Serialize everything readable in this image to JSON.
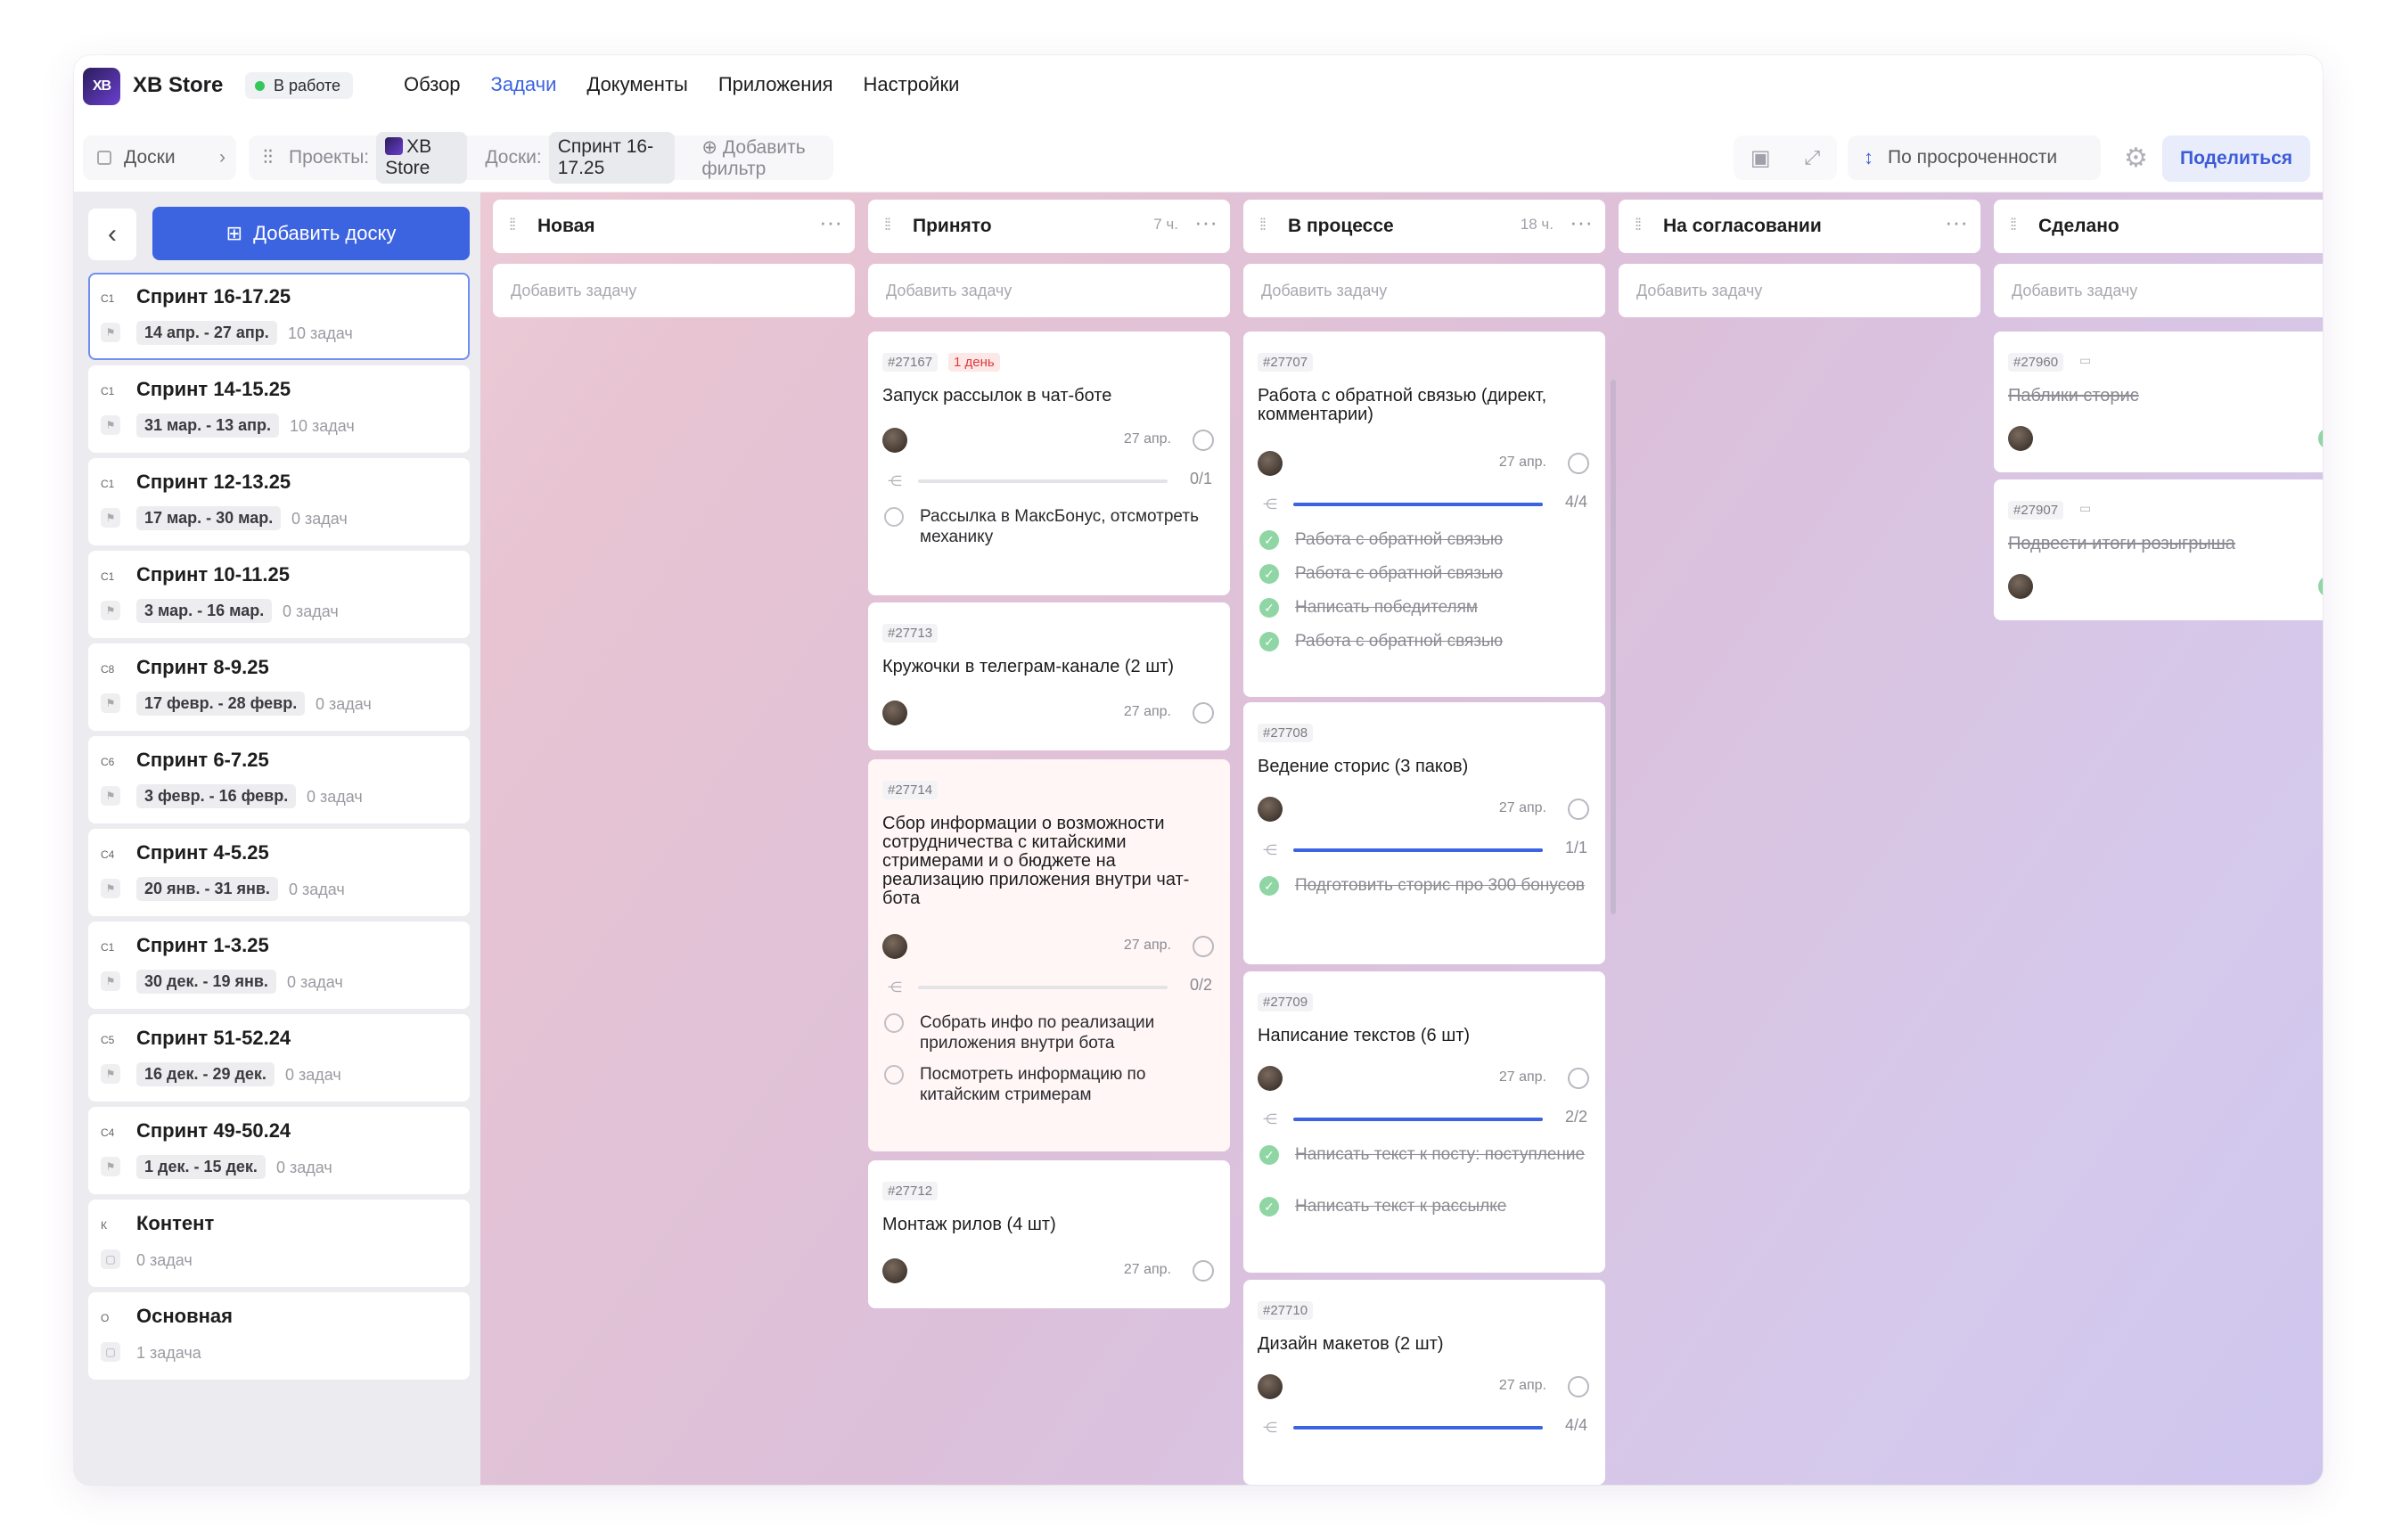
{
  "app": {
    "name": "XB Store",
    "logo_text": "XB",
    "status": "В работе"
  },
  "nav": [
    "Обзор",
    "Задачи",
    "Документы",
    "Приложения",
    "Настройки"
  ],
  "filters": {
    "boards_label": "Доски",
    "projects_label": "Проекты:",
    "project_value": "XB Store",
    "boards_filter_label": "Доски:",
    "boards_filter_value": "Спринт 16-17.25",
    "add_filter": "Добавить фильтр",
    "sort": "По просроченности",
    "share": "Поделиться"
  },
  "sidebar": {
    "add_board": "Добавить доску",
    "boards": [
      {
        "code": "С1",
        "name": "Спринт 16-17.25",
        "dates": "14 апр. - 27 апр.",
        "count": "10 задач"
      },
      {
        "code": "С1",
        "name": "Спринт 14-15.25",
        "dates": "31 мар. - 13 апр.",
        "count": "10 задач"
      },
      {
        "code": "С1",
        "name": "Спринт 12-13.25",
        "dates": "17 мар. - 30 мар.",
        "count": "0 задач"
      },
      {
        "code": "С1",
        "name": "Спринт 10-11.25",
        "dates": "3 мар. - 16 мар.",
        "count": "0 задач"
      },
      {
        "code": "С8",
        "name": "Спринт 8-9.25",
        "dates": "17 февр. - 28 февр.",
        "count": "0 задач"
      },
      {
        "code": "С6",
        "name": "Спринт 6-7.25",
        "dates": "3 февр. - 16 февр.",
        "count": "0 задач"
      },
      {
        "code": "С4",
        "name": "Спринт 4-5.25",
        "dates": "20 янв. - 31 янв.",
        "count": "0 задач"
      },
      {
        "code": "С1",
        "name": "Спринт 1-3.25",
        "dates": "30 дек. - 19 янв.",
        "count": "0 задач"
      },
      {
        "code": "С5",
        "name": "Спринт 51-52.24",
        "dates": "16 дек. - 29 дек.",
        "count": "0 задач"
      },
      {
        "code": "С4",
        "name": "Спринт 49-50.24",
        "dates": "1 дек. - 15 дек.",
        "count": "0 задач"
      },
      {
        "code": "К",
        "name": "Контент",
        "dates": "",
        "count": "0 задач"
      },
      {
        "code": "О",
        "name": "Основная",
        "dates": "",
        "count": "1 задача"
      }
    ]
  },
  "columns": [
    {
      "title": "Новая",
      "hours": ""
    },
    {
      "title": "Принято",
      "hours": "7 ч."
    },
    {
      "title": "В процессе",
      "hours": "18 ч."
    },
    {
      "title": "На согласовании",
      "hours": ""
    },
    {
      "title": "Сделано",
      "hours": ""
    }
  ],
  "add_task": "Добавить задачу",
  "cards": {
    "accepted": [
      {
        "id": "#27167",
        "badge": "1 день",
        "title": "Запуск рассылок в чат-боте",
        "date": "27 апр.",
        "progress": "0/1",
        "progress_frac": 0,
        "checklist": [
          {
            "text": "Рассылка в МаксБонус, отсмотреть механику",
            "done": false
          }
        ]
      },
      {
        "id": "#27713",
        "title": "Кружочки в телеграм-канале (2 шт)",
        "date": "27 апр."
      },
      {
        "id": "#27714",
        "title": "Сбор информации о возможности сотрудничества с китайскими стримерами и о бюджете на реализацию приложения внутри чат-бота",
        "date": "27 апр.",
        "progress": "0/2",
        "progress_frac": 0,
        "checklist": [
          {
            "text": "Собрать инфо по реализации приложения внутри бота",
            "done": false
          },
          {
            "text": "Посмотреть информацию по китайским стримерам",
            "done": false
          }
        ]
      },
      {
        "id": "#27712",
        "title": "Монтаж рилов (4 шт)",
        "date": "27 апр."
      }
    ],
    "in_progress": [
      {
        "id": "#27707",
        "title": "Работа с обратной связью (директ, комментарии)",
        "date": "27 апр.",
        "progress": "4/4",
        "progress_frac": 1,
        "checklist": [
          {
            "text": "Работа с обратной связью",
            "done": true
          },
          {
            "text": "Работа с обратной связью",
            "done": true
          },
          {
            "text": "Написать победителям",
            "done": true
          },
          {
            "text": "Работа с обратной связью",
            "done": true
          }
        ]
      },
      {
        "id": "#27708",
        "title": "Ведение сторис (3 паков)",
        "date": "27 апр.",
        "progress": "1/1",
        "progress_frac": 1,
        "checklist": [
          {
            "text": "Подготовить сторис про 300 бонусов",
            "done": true
          }
        ]
      },
      {
        "id": "#27709",
        "title": "Написание текстов (6 шт)",
        "date": "27 апр.",
        "progress": "2/2",
        "progress_frac": 1,
        "checklist": [
          {
            "text": "Написать текст к посту: поступление",
            "done": true
          },
          {
            "text": "Написать текст к рассылке",
            "done": true
          }
        ]
      },
      {
        "id": "#27710",
        "title": "Дизайн макетов (2 шт)",
        "date": "27 апр.",
        "progress": "4/4",
        "progress_frac": 1
      }
    ],
    "done": [
      {
        "id": "#27960",
        "title": "Паблики сторис"
      },
      {
        "id": "#27907",
        "title": "Подвести итоги розыгрыша"
      }
    ]
  },
  "colors": {
    "accent": "#3c64e0",
    "status": "#34c759",
    "badge_red": "#e0383b"
  }
}
